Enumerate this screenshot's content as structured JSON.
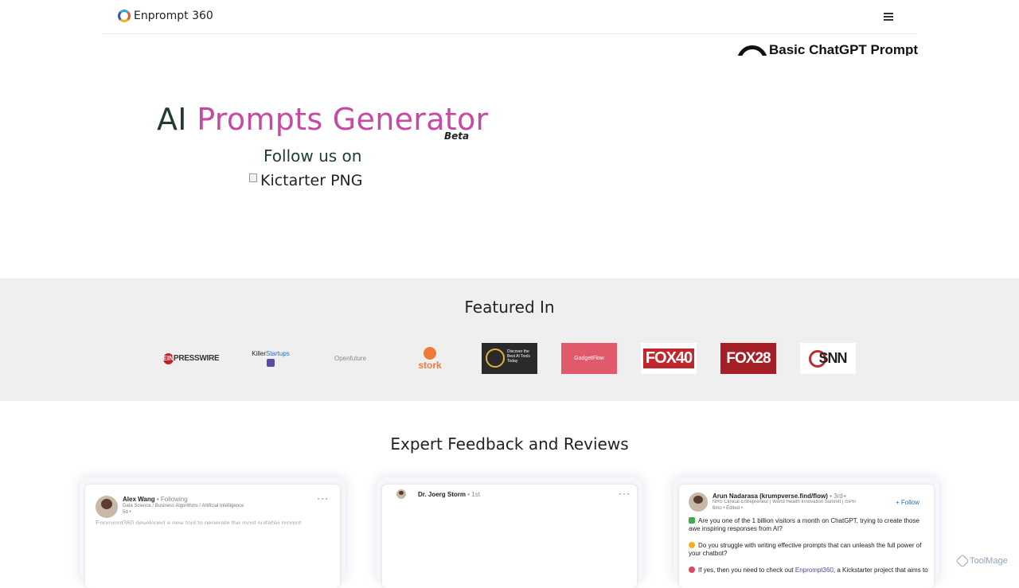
{
  "nav": {
    "brand": "Enprompt 360"
  },
  "carousel": {
    "text": "Basic ChatGPT Prompt"
  },
  "hero": {
    "title_prefix": "AI",
    "title_highlight": "Prompts Generator",
    "badge": "Beta",
    "follow_label": "Follow us on",
    "kickstarter_alt": "Kictarter PNG"
  },
  "featured": {
    "title": "Featured In",
    "logos": {
      "ein_mark": "EIN",
      "ein_text": "PRESSWIRE",
      "killer_a": "Killer",
      "killer_b": "Startups",
      "open": "Openfuture",
      "stork": "stork",
      "aitools": "Discover the Best AI Tools Today",
      "gadget": "GadgetFlow",
      "fox40": "FOX40",
      "fox28": "FOX28",
      "snn": "SNN"
    }
  },
  "reviews": {
    "title": "Expert Feedback and Reviews",
    "cards": [
      {
        "name": "Alex Wang",
        "degree": "• Following",
        "headline": "Data Science / Business Algorithms / Artificial Intelligence",
        "meta": "5d •",
        "body": "Enprompt360 developed a new tool to generate the most suitable prompt"
      },
      {
        "name": "Dr. Joerg Storm",
        "degree": "• 1st"
      },
      {
        "name": "Arun Nadarasa (krumpverse.find/flow)",
        "degree": "• 3rd+",
        "headline": "NHS Clinical Entrepreneur | World Health Innovation Summit | ISPPA |...",
        "meta": "6mo • Edited •",
        "follow": "+ Follow",
        "body_1": "Are you one of the 1 billion visitors a month on ChatGPT, trying to create those awe inspiring responses from AI?",
        "body_2": "Do you struggle with writing effective prompts that can unleash the full power of your chatbot?",
        "body_3_prefix": "If yes, then you need to check out",
        "body_3_link": "Enprompt360",
        "body_3_suffix": ", a Kickstarter project that aims to"
      }
    ]
  },
  "watermark": "ToolMage",
  "colors": {
    "title_dark": "#1f3d2a",
    "title_pink": "#c64aa3",
    "band_bg": "#efefef"
  }
}
